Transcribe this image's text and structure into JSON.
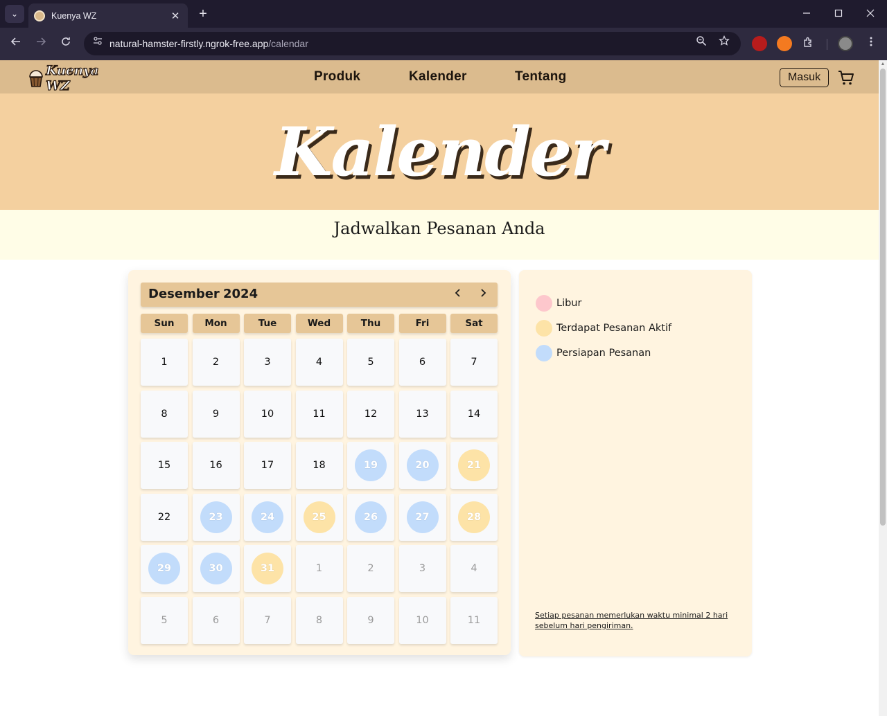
{
  "browser": {
    "tab_title": "Kuenya WZ",
    "url_host": "natural-hamster-firstly.ngrok-free.app",
    "url_path": "/calendar",
    "new_tab_glyph": "+",
    "close_glyph": "✕"
  },
  "nav": {
    "logo_text": "Kuenya WZ",
    "links": [
      {
        "label": "Produk"
      },
      {
        "label": "Kalender"
      },
      {
        "label": "Tentang"
      }
    ],
    "login_label": "Masuk"
  },
  "hero": {
    "title": "Kalender",
    "subtitle": "Jadwalkan Pesanan Anda"
  },
  "calendar": {
    "month": "Desember",
    "year": "2024",
    "weekdays": [
      "Sun",
      "Mon",
      "Tue",
      "Wed",
      "Thu",
      "Fri",
      "Sat"
    ],
    "weeks": [
      [
        {
          "d": "1",
          "s": "normal"
        },
        {
          "d": "2",
          "s": "normal"
        },
        {
          "d": "3",
          "s": "normal"
        },
        {
          "d": "4",
          "s": "normal"
        },
        {
          "d": "5",
          "s": "normal"
        },
        {
          "d": "6",
          "s": "normal"
        },
        {
          "d": "7",
          "s": "normal"
        }
      ],
      [
        {
          "d": "8",
          "s": "normal"
        },
        {
          "d": "9",
          "s": "normal"
        },
        {
          "d": "10",
          "s": "normal"
        },
        {
          "d": "11",
          "s": "normal"
        },
        {
          "d": "12",
          "s": "normal"
        },
        {
          "d": "13",
          "s": "normal"
        },
        {
          "d": "14",
          "s": "normal"
        }
      ],
      [
        {
          "d": "15",
          "s": "normal"
        },
        {
          "d": "16",
          "s": "normal"
        },
        {
          "d": "17",
          "s": "normal"
        },
        {
          "d": "18",
          "s": "normal"
        },
        {
          "d": "19",
          "s": "prep"
        },
        {
          "d": "20",
          "s": "prep"
        },
        {
          "d": "21",
          "s": "active"
        }
      ],
      [
        {
          "d": "22",
          "s": "normal"
        },
        {
          "d": "23",
          "s": "prep"
        },
        {
          "d": "24",
          "s": "prep"
        },
        {
          "d": "25",
          "s": "active"
        },
        {
          "d": "26",
          "s": "prep"
        },
        {
          "d": "27",
          "s": "prep"
        },
        {
          "d": "28",
          "s": "active"
        }
      ],
      [
        {
          "d": "29",
          "s": "prep"
        },
        {
          "d": "30",
          "s": "prep"
        },
        {
          "d": "31",
          "s": "active"
        },
        {
          "d": "1",
          "s": "other"
        },
        {
          "d": "2",
          "s": "other"
        },
        {
          "d": "3",
          "s": "other"
        },
        {
          "d": "4",
          "s": "other"
        }
      ],
      [
        {
          "d": "5",
          "s": "other"
        },
        {
          "d": "6",
          "s": "other"
        },
        {
          "d": "7",
          "s": "other"
        },
        {
          "d": "8",
          "s": "other"
        },
        {
          "d": "9",
          "s": "other"
        },
        {
          "d": "10",
          "s": "other"
        },
        {
          "d": "11",
          "s": "other"
        }
      ]
    ]
  },
  "legend": {
    "items": [
      {
        "label": "Libur",
        "color": "#fdc7cc"
      },
      {
        "label": "Terdapat Pesanan Aktif",
        "color": "#fde3a7"
      },
      {
        "label": "Persiapan Pesanan",
        "color": "#c2dcfb"
      }
    ],
    "note": "Setiap pesanan memerlukan waktu minimal 2 hari sebelum hari pengiriman."
  },
  "colors": {
    "nav_bg": "#dbbb8e",
    "hero_bg": "#f4d09f",
    "subtitle_bg": "#fffde7",
    "card_bg": "#fff4e0",
    "header_bg": "#e6c697",
    "prep": "#c2dcfb",
    "active": "#fde3a7",
    "holiday": "#fdc7cc"
  },
  "icons": {
    "tab_menu": "chevron-down-icon",
    "back": "arrow-left-icon",
    "forward": "arrow-right-icon",
    "reload": "reload-icon",
    "site_info": "site-settings-icon",
    "zoom": "zoom-icon",
    "bookmark": "star-icon",
    "extensions": "puzzle-icon",
    "menu": "kebab-menu-icon",
    "cart": "cart-icon",
    "prev": "chevron-left-icon",
    "next": "chevron-right-icon"
  }
}
